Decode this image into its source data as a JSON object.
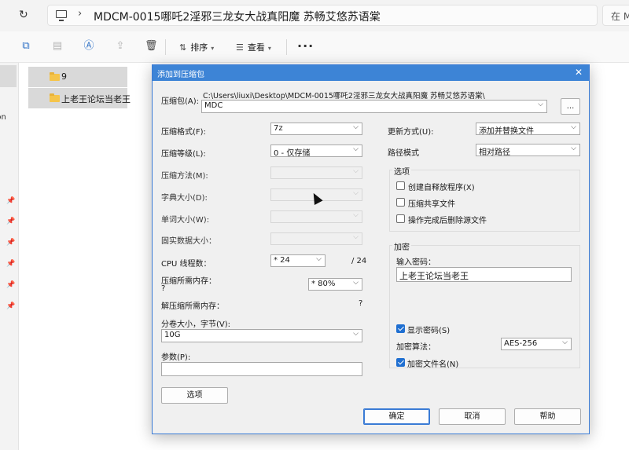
{
  "explorer": {
    "path": "MDCM-0015哪吒2淫邪三龙女大战真阳魔 苏畅艾悠苏语棠",
    "search_placeholder": "在 M",
    "toolbar": {
      "sort_label": "排序",
      "view_label": "查看",
      "more_label": "···"
    },
    "nav_fragment": "rson",
    "folders": [
      {
        "name": "9"
      },
      {
        "name": "上老王论坛当老王"
      }
    ]
  },
  "dialog": {
    "title": "添加到压缩包",
    "close_icon": "✕",
    "archive_label": "压缩包(A):",
    "archive_path": "C:\\Users\\liuxi\\Desktop\\MDCM-0015哪吒2淫邪三龙女大战真阳魔 苏畅艾悠苏语棠\\",
    "archive_name": "MDC",
    "browse_label": "...",
    "left": {
      "format_label": "压缩格式(F):",
      "format_value": "7z",
      "level_label": "压缩等级(L):",
      "level_value": "0 - 仅存储",
      "method_label": "压缩方法(M):",
      "method_value": "",
      "dict_label": "字典大小(D):",
      "dict_value": "",
      "word_label": "单词大小(W):",
      "word_value": "",
      "solid_label": "固实数据大小：",
      "solid_value": "",
      "threads_label": "CPU 线程数：",
      "threads_value": "* 24",
      "threads_max": "/ 24",
      "mem_comp_label": "压缩所需内存：",
      "mem_comp_value": "?",
      "mem_percent": "* 80%",
      "mem_decomp_label": "解压缩所需内存：",
      "mem_decomp_value": "?",
      "volume_label": "分卷大小，字节(V):",
      "volume_value": "10G",
      "params_label": "参数(P):",
      "params_value": "",
      "options_button": "选项"
    },
    "right": {
      "update_label": "更新方式(U):",
      "update_value": "添加并替换文件",
      "pathmode_label": "路径模式",
      "pathmode_value": "相对路径",
      "options_group": "选项",
      "opt_sfx": "创建自释放程序(X)",
      "opt_shared": "压缩共享文件",
      "opt_delete": "操作完成后删除源文件",
      "encrypt_group": "加密",
      "password_label": "输入密码：",
      "password_value": "上老王论坛当老王",
      "show_password": "显示密码(S)",
      "algo_label": "加密算法：",
      "algo_value": "AES-256",
      "encrypt_names": "加密文件名(N)"
    },
    "ok_button": "确定",
    "cancel_button": "取消",
    "help_button": "帮助"
  }
}
